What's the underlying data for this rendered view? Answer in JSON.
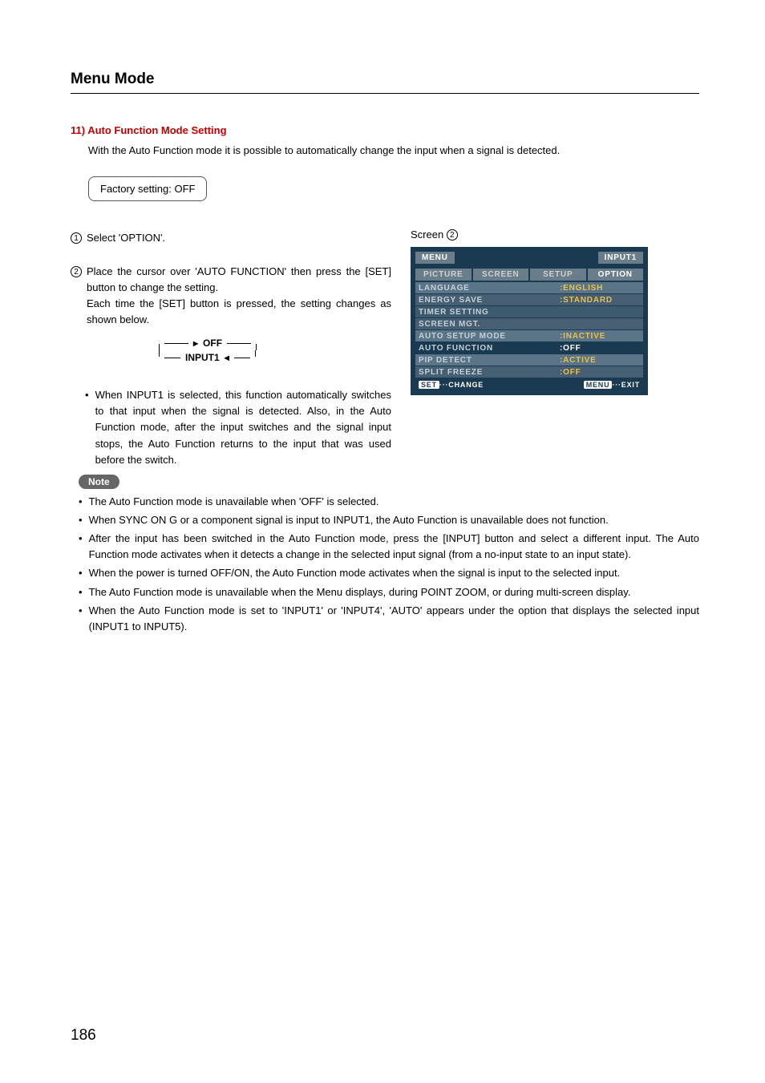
{
  "page_title": "Menu Mode",
  "page_number": "186",
  "section": {
    "number": "11)",
    "title": "Auto Function Mode Setting",
    "intro": "With the Auto Function mode it is possible to automatically change the input when a signal is detected.",
    "factory_setting": "Factory setting: OFF"
  },
  "steps": {
    "one": "Select 'OPTION'.",
    "two_a": "Place the cursor over 'AUTO FUNCTION' then press the [SET] button to change the setting.",
    "two_b": "Each time the [SET] button is pressed, the setting changes as shown below.",
    "toggle_off": "OFF",
    "toggle_input1": "INPUT1",
    "bullet": "When INPUT1 is selected, this function automatically switches to that input when the signal is detected.  Also, in the Auto Function mode, after the input switches and the signal input stops, the Auto Function returns to the input that was used before the switch."
  },
  "screen": {
    "label_prefix": "Screen",
    "label_num": "2",
    "header_left": "MENU",
    "header_right": "INPUT1",
    "tabs": [
      "PICTURE",
      "SCREEN",
      "SETUP",
      "OPTION"
    ],
    "rows": [
      {
        "label": "LANGUAGE",
        "value": ":ENGLISH",
        "cls": "highlight"
      },
      {
        "label": "ENERGY SAVE",
        "value": ":STANDARD",
        "cls": "alt"
      },
      {
        "label": "TIMER SETTING",
        "value": "",
        "cls": ""
      },
      {
        "label": "SCREEN MGT.",
        "value": "",
        "cls": "alt"
      },
      {
        "label": "AUTO SETUP MODE",
        "value": ":INACTIVE",
        "cls": "highlight"
      },
      {
        "label": "AUTO FUNCTION",
        "value": ":OFF",
        "cls": "selected",
        "val_cls": "white"
      },
      {
        "label": "PIP DETECT",
        "value": ":ACTIVE",
        "cls": "highlight"
      },
      {
        "label": "SPLIT FREEZE",
        "value": ":OFF",
        "cls": "alt"
      }
    ],
    "footer_left_key": "SET",
    "footer_left_text": "···CHANGE",
    "footer_right_key": "MENU",
    "footer_right_text": "···EXIT"
  },
  "note_label": "Note",
  "notes": [
    "The Auto Function mode is unavailable when 'OFF' is selected.",
    "When SYNC ON G or a component signal is input to INPUT1, the Auto Function is unavailable does not function.",
    "After the input has been switched in the Auto Function mode, press the [INPUT] button and select a different input. The Auto Function mode activates when it detects a change in the selected input signal (from a no-input state to an input state).",
    "When the power is turned OFF/ON, the Auto Function mode activates when the signal is input to the selected input.",
    "The Auto Function mode is unavailable when the Menu displays, during POINT ZOOM, or during multi-screen display.",
    "When the Auto Function mode is set to 'INPUT1' or 'INPUT4', 'AUTO' appears under the option that displays the selected input (INPUT1 to INPUT5)."
  ]
}
